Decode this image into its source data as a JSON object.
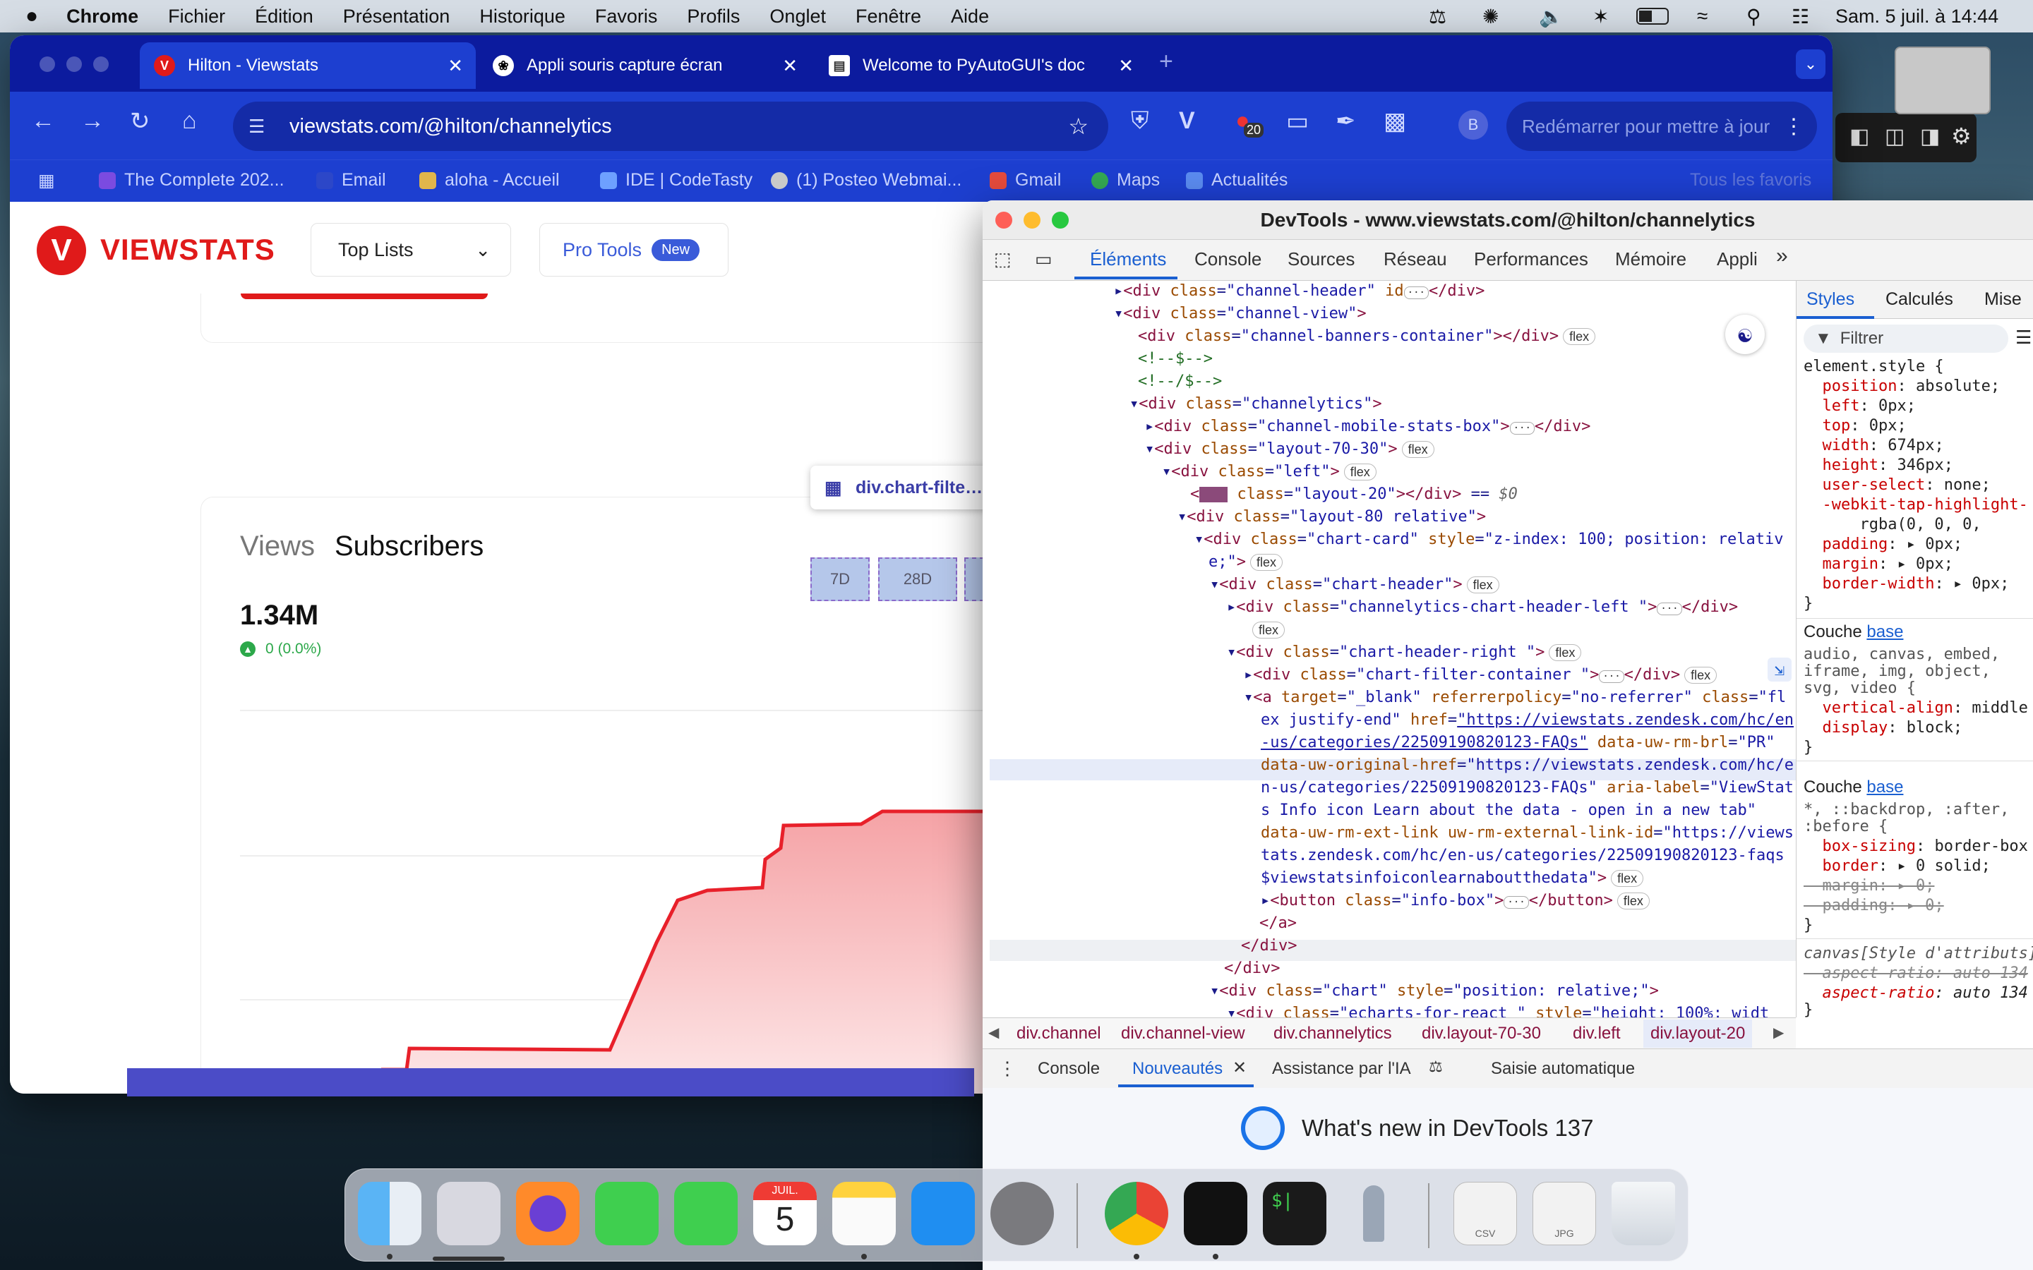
{
  "menubar": {
    "app": "Chrome",
    "items": [
      "Fichier",
      "Édition",
      "Présentation",
      "Historique",
      "Favoris",
      "Profils",
      "Onglet",
      "Fenêtre",
      "Aide"
    ],
    "clock": "Sam. 5 juil. à  14:44"
  },
  "browser": {
    "tabs": [
      {
        "title": "Hilton - Viewstats"
      },
      {
        "title": "Appli souris capture écran"
      },
      {
        "title": "Welcome to PyAutoGUI's doc"
      }
    ],
    "new_tab": "+",
    "url": "viewstats.com/@hilton/channelytics",
    "ext_badge": "20",
    "profile_initial": "B",
    "restart_label": "Redémarrer pour mettre à jour",
    "bookmarks": [
      "The Complete 202...",
      "Email",
      "aloha - Accueil",
      "IDE | CodeTasty",
      "(1) Posteo Webmai...",
      "Gmail",
      "Maps",
      "Actualités"
    ],
    "all_bookmarks": "Tous les favoris"
  },
  "page": {
    "logo_letter": "V",
    "logo_text": "VIEWSTATS",
    "top_lists": "Top Lists",
    "pro_tools": "Pro Tools",
    "new_badge": "New",
    "tab_views": "Views",
    "tab_subscribers": "Subscribers",
    "big_value": "1.34M",
    "delta": "0 (0.0%)",
    "tooltip": "div.chart-filte…",
    "filters": [
      "7D",
      "28D"
    ],
    "colors": {
      "brand": "#e01a1a",
      "accent": "#3a5bd9",
      "line": "#e8202a"
    }
  },
  "chart_data": {
    "type": "area",
    "title": "",
    "series": [
      {
        "name": "Subscribers",
        "trend": "step-up"
      }
    ]
  },
  "devtools": {
    "title": "DevTools - www.viewstats.com/@hilton/channelytics",
    "tabs": [
      "Éléments",
      "Console",
      "Sources",
      "Réseau",
      "Performances",
      "Mémoire",
      "Appli"
    ],
    "more": "»",
    "styles_tabs": [
      "Styles",
      "Calculés",
      "Mise"
    ],
    "filter_placeholder": "Filtrer",
    "breadcrumbs": [
      "div.channel",
      "div.channel-view",
      "div.channelytics",
      "div.layout-70-30",
      "div.left",
      "div.layout-20"
    ],
    "drawer_tabs": [
      "Console",
      "Nouveautés",
      "Assistance par l'IA",
      "Saisie automatique"
    ],
    "whats_new": "What's new in DevTools 137"
  },
  "dock": {
    "calendar_month": "JUIL.",
    "calendar_day": "5",
    "csv": "CSV",
    "jpg": "JPG"
  }
}
